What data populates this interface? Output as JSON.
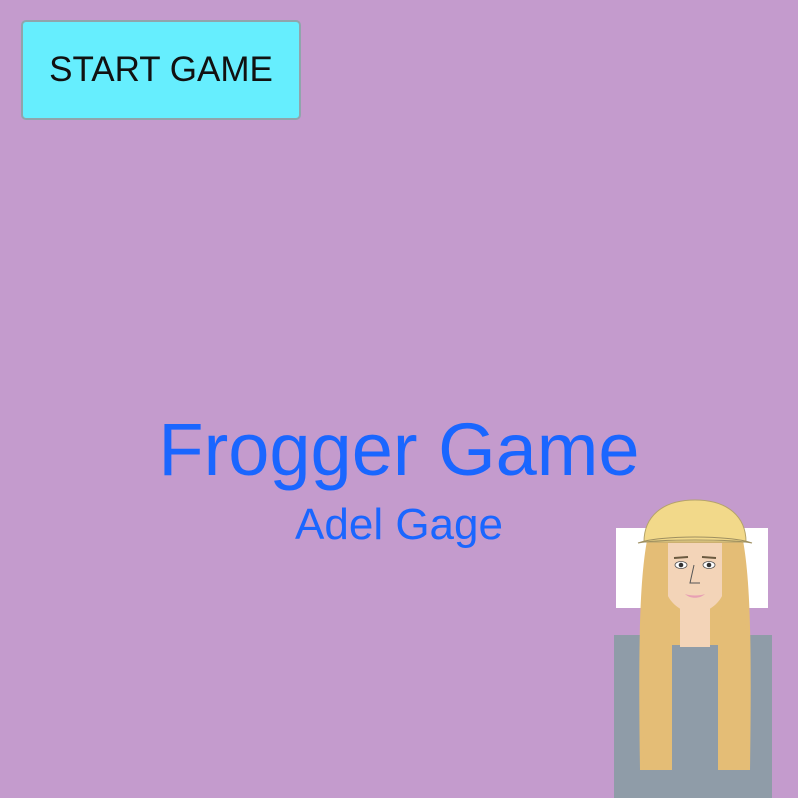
{
  "screen": {
    "background": "#c49bcd"
  },
  "start_button": {
    "label": "START GAME",
    "color": "#66eefe"
  },
  "title": {
    "text": "Frogger Game",
    "color": "#1a66ff"
  },
  "subtitle": {
    "text": "Adel Gage",
    "color": "#1a66ff"
  },
  "character": {
    "cap_color": "#f2d98a",
    "hair_color": "#e4bd76",
    "skin_color": "#f3d4b8",
    "shirt_color": "#8f9ca8",
    "lip_color": "#e8a0b4"
  }
}
